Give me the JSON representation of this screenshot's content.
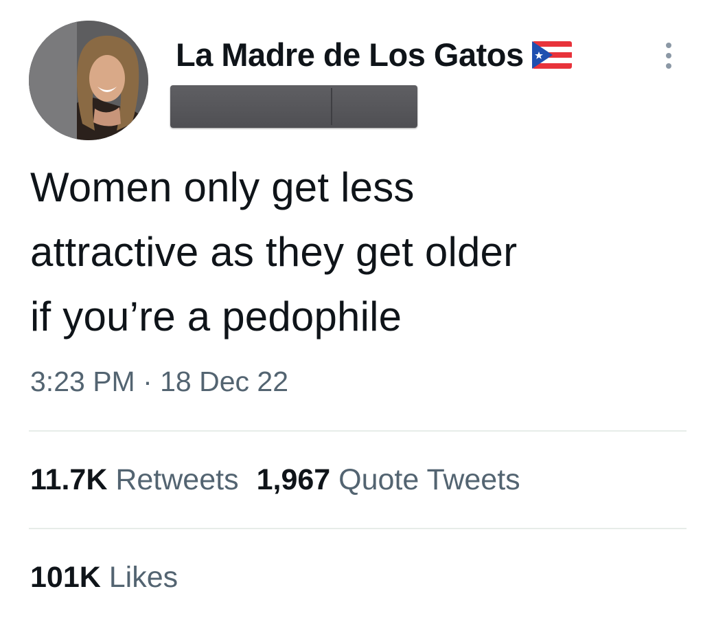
{
  "tweet": {
    "display_name": "La Madre de Los Gatos",
    "flag_icon": "puerto-rico-flag-icon",
    "more_icon": "more-options-icon",
    "text_lines": [
      "Women only get less",
      "attractive as they get older",
      "if you’re a pedophile"
    ],
    "timestamp": "3:23 PM · 18 Dec 22",
    "stats": {
      "retweets_count": "11.7K",
      "retweets_label": "Retweets",
      "quotes_count": "1,967",
      "quotes_label": "Quote Tweets",
      "likes_count": "101K",
      "likes_label": "Likes"
    }
  },
  "colors": {
    "text_primary": "#0f1419",
    "text_secondary": "#536471",
    "divider": "#e6ece8",
    "redaction": "#58585c"
  }
}
